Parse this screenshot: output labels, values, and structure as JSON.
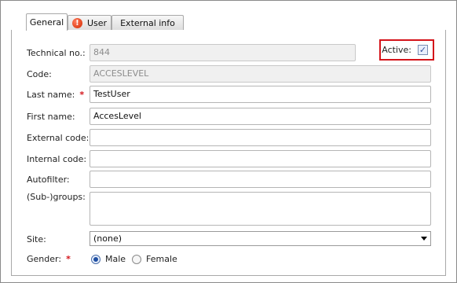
{
  "tabs": [
    {
      "label": "General",
      "active": true
    },
    {
      "label": "User",
      "active": false,
      "icon": "alert-icon"
    },
    {
      "label": "External info",
      "active": false
    }
  ],
  "active": {
    "label": "Active:",
    "checked": true
  },
  "fields": {
    "technical_no": {
      "label": "Technical no.:",
      "value": "844"
    },
    "code": {
      "label": "Code:",
      "value": "ACCESLEVEL"
    },
    "last_name": {
      "label": "Last name:",
      "value": "TestUser",
      "required": "*"
    },
    "first_name": {
      "label": "First name:",
      "value": "AccesLevel"
    },
    "external_code": {
      "label": "External code:",
      "value": ""
    },
    "internal_code": {
      "label": "Internal code:",
      "value": ""
    },
    "autofilter": {
      "label": "Autofilter:",
      "value": ""
    },
    "subgroups": {
      "label": "(Sub-)groups:",
      "value": ""
    },
    "site": {
      "label": "Site:",
      "value": "(none)"
    },
    "gender": {
      "label": "Gender:",
      "required": "*",
      "options": [
        "Male",
        "Female"
      ],
      "selected": "Male"
    }
  },
  "colors": {
    "required": "#d4141a",
    "highlight_border": "#d4141a"
  }
}
